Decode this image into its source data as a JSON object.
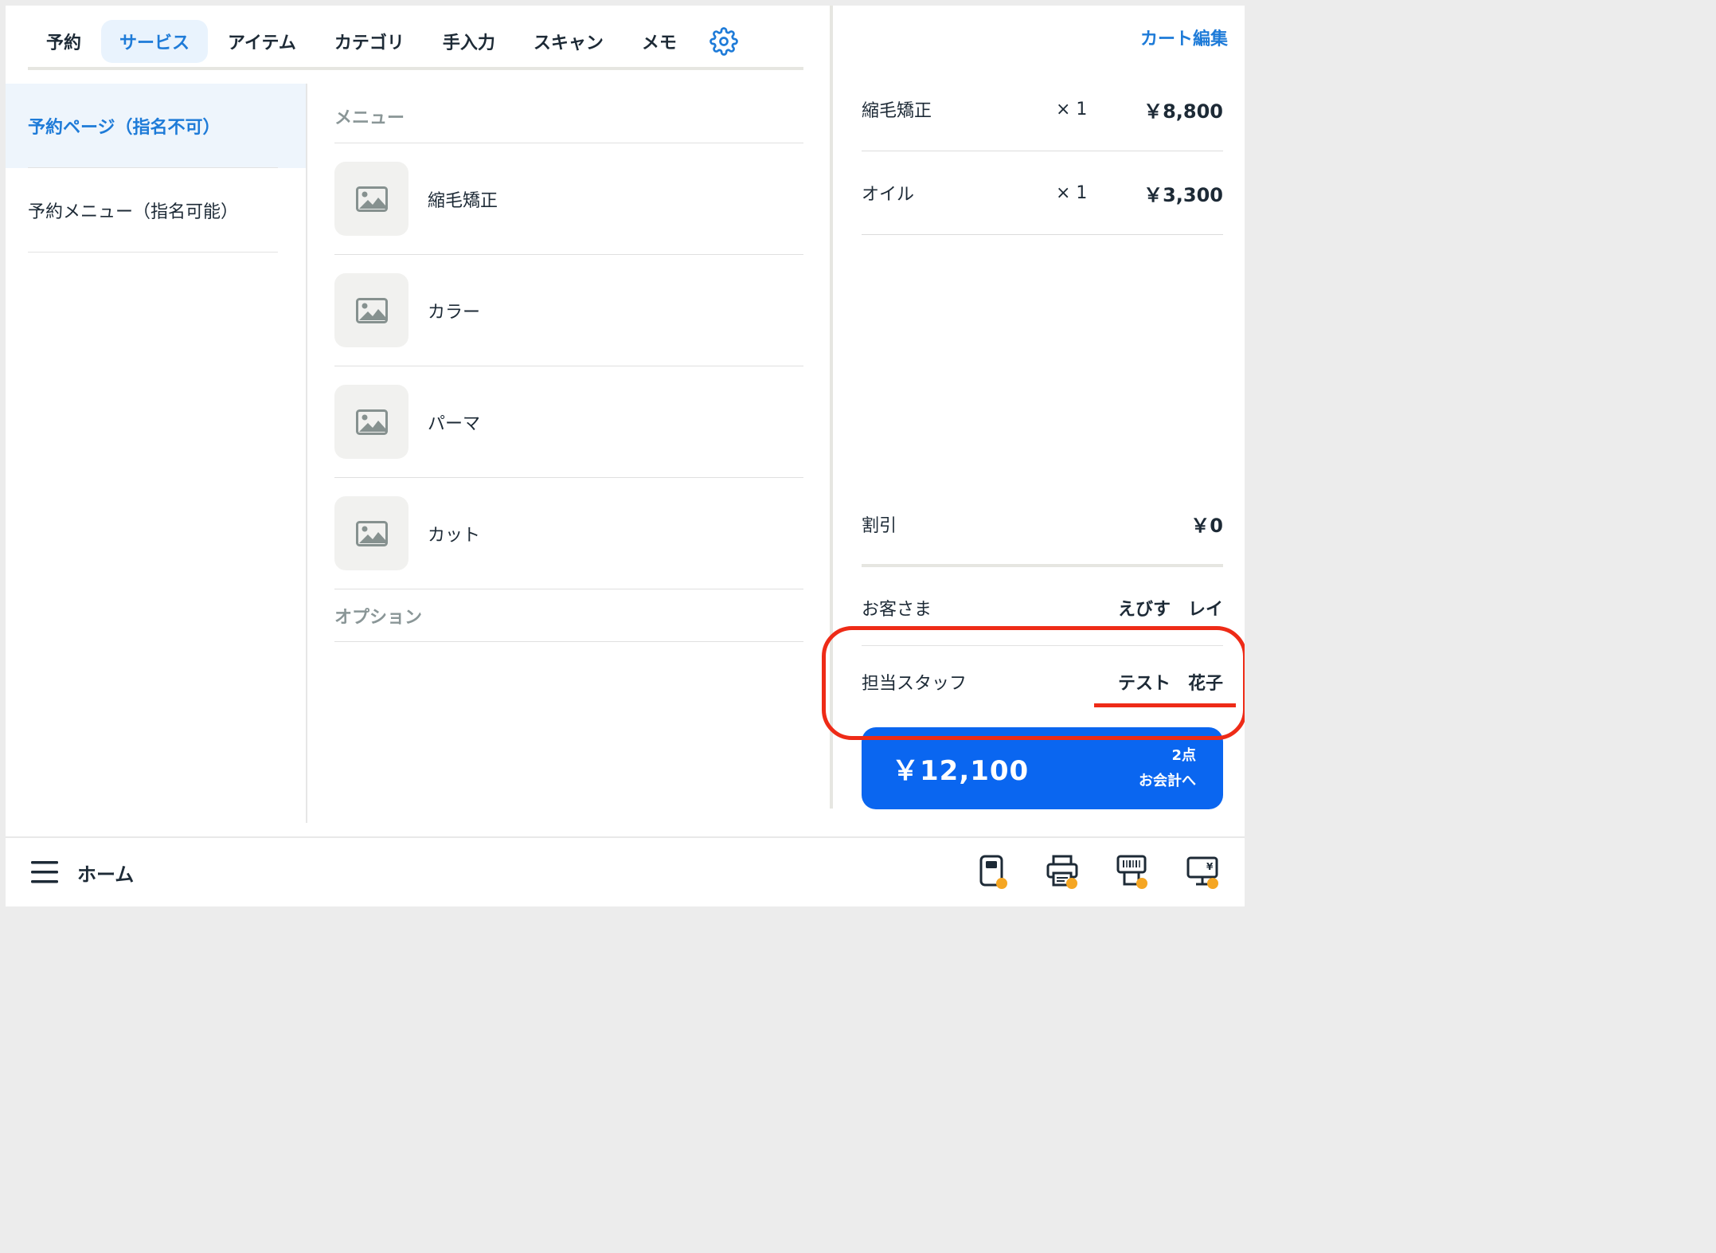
{
  "tabs": [
    {
      "label": "予約",
      "active": false
    },
    {
      "label": "サービス",
      "active": true
    },
    {
      "label": "アイテム",
      "active": false
    },
    {
      "label": "カテゴリ",
      "active": false
    },
    {
      "label": "手入力",
      "active": false
    },
    {
      "label": "スキャン",
      "active": false
    },
    {
      "label": "メモ",
      "active": false
    }
  ],
  "settings_icon": "gear-icon",
  "sidebar": {
    "items": [
      {
        "label": "予約ページ（指名不可）",
        "active": true
      },
      {
        "label": "予約メニュー（指名可能）",
        "active": false
      }
    ]
  },
  "products": {
    "menu_header": "メニュー",
    "items": [
      {
        "name": "縮毛矯正",
        "icon": "image-placeholder-icon"
      },
      {
        "name": "カラー",
        "icon": "image-placeholder-icon"
      },
      {
        "name": "パーマ",
        "icon": "image-placeholder-icon"
      },
      {
        "name": "カット",
        "icon": "image-placeholder-icon"
      }
    ],
    "option_header": "オプション"
  },
  "cart": {
    "edit_label": "カート編集",
    "lines": [
      {
        "name": "縮毛矯正",
        "qty": "× 1",
        "price": "￥8,800"
      },
      {
        "name": "オイル",
        "qty": "× 1",
        "price": "￥3,300"
      }
    ],
    "discount_label": "割引",
    "discount_value": "￥0",
    "customer_label": "お客さま",
    "customer_value": "えびす　レイ",
    "staff_label": "担当スタッフ",
    "staff_value": "テスト　花子",
    "total": "￥12,100",
    "count": "2点",
    "checkout_label": "お会計へ"
  },
  "bottom_bar": {
    "home_label": "ホーム",
    "menu_icon": "hamburger-menu-icon",
    "device_icons": [
      "card-reader-icon",
      "receipt-printer-icon",
      "barcode-printer-icon",
      "customer-display-icon"
    ],
    "status_color": "#f5a623"
  },
  "colors": {
    "accent": "#1e7bd8",
    "checkout": "#0a66f0",
    "highlight": "#ee2b17"
  }
}
